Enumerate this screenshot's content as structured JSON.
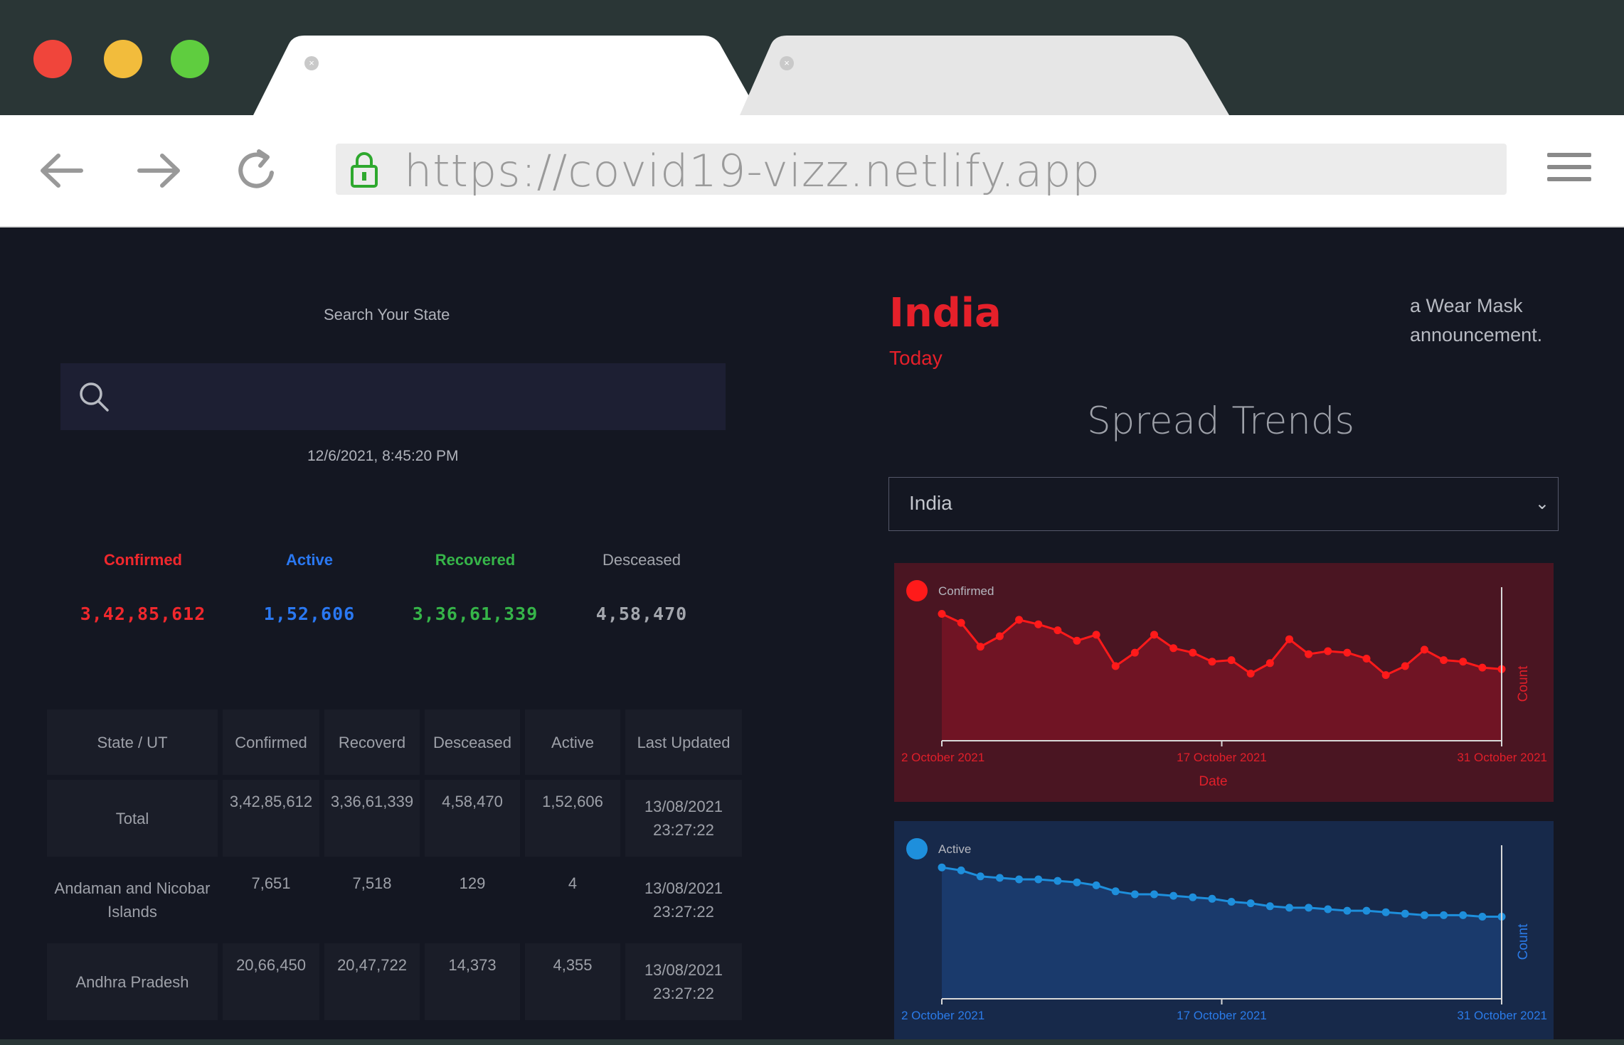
{
  "browser": {
    "url": "https://covid19-vizz.netlify.app",
    "tabs": [
      {
        "label": "",
        "close": "×"
      },
      {
        "label": "",
        "close": "×"
      }
    ]
  },
  "search": {
    "label": "Search Your State",
    "placeholder": ""
  },
  "timestamp": "12/6/2021, 8:45:20 PM",
  "stats": [
    {
      "label": "Confirmed",
      "value": "3,42,85,612",
      "color": "#f0282d"
    },
    {
      "label": "Active",
      "value": "1,52,606",
      "color": "#2a78f2"
    },
    {
      "label": "Recovered",
      "value": "3,36,61,339",
      "color": "#36b549"
    },
    {
      "label": "Desceased",
      "value": "4,58,470",
      "color": "#a3a6ad"
    }
  ],
  "table": {
    "headers": [
      "State / UT",
      "Confirmed",
      "Recoverd",
      "Desceased",
      "Active",
      "Last Updated"
    ],
    "rows": [
      [
        "Total",
        "3,42,85,612",
        "3,36,61,339",
        "4,58,470",
        "1,52,606",
        "13/08/2021 23:27:22"
      ],
      [
        "Andaman and Nicobar Islands",
        "7,651",
        "7,518",
        "129",
        "4",
        "13/08/2021 23:27:22"
      ],
      [
        "Andhra Pradesh",
        "20,66,450",
        "20,47,722",
        "14,373",
        "4,355",
        "13/08/2021 23:27:22"
      ]
    ]
  },
  "right": {
    "country": "India",
    "today": "Today",
    "announcement": "a Wear Mask announcement.",
    "spread_title": "Spread Trends",
    "selected_country": "India"
  },
  "chart_data": [
    {
      "type": "area",
      "legend": "Confirmed",
      "color": "#ff1a1a",
      "xlabel": "Date",
      "ylabel": "Count",
      "xticks": [
        "2 October 2021",
        "17 October 2021",
        "31 October 2021"
      ],
      "x": [
        "2021-10-02",
        "2021-10-03",
        "2021-10-04",
        "2021-10-05",
        "2021-10-06",
        "2021-10-07",
        "2021-10-08",
        "2021-10-09",
        "2021-10-10",
        "2021-10-11",
        "2021-10-12",
        "2021-10-13",
        "2021-10-14",
        "2021-10-15",
        "2021-10-16",
        "2021-10-17",
        "2021-10-18",
        "2021-10-19",
        "2021-10-20",
        "2021-10-21",
        "2021-10-22",
        "2021-10-23",
        "2021-10-24",
        "2021-10-25",
        "2021-10-26",
        "2021-10-27",
        "2021-10-28",
        "2021-10-29",
        "2021-10-30",
        "2021-10-31"
      ],
      "values": [
        0.85,
        0.79,
        0.63,
        0.7,
        0.81,
        0.78,
        0.74,
        0.67,
        0.71,
        0.5,
        0.59,
        0.71,
        0.62,
        0.59,
        0.53,
        0.54,
        0.45,
        0.52,
        0.68,
        0.58,
        0.6,
        0.59,
        0.55,
        0.44,
        0.5,
        0.61,
        0.54,
        0.53,
        0.49,
        0.48
      ]
    },
    {
      "type": "area",
      "legend": "Active",
      "color": "#1e8fdc",
      "ylabel": "Count",
      "xticks": [
        "2 October 2021",
        "17 October 2021",
        "31 October 2021"
      ],
      "x": [
        "2021-10-02",
        "2021-10-03",
        "2021-10-04",
        "2021-10-05",
        "2021-10-06",
        "2021-10-07",
        "2021-10-08",
        "2021-10-09",
        "2021-10-10",
        "2021-10-11",
        "2021-10-12",
        "2021-10-13",
        "2021-10-14",
        "2021-10-15",
        "2021-10-16",
        "2021-10-17",
        "2021-10-18",
        "2021-10-19",
        "2021-10-20",
        "2021-10-21",
        "2021-10-22",
        "2021-10-23",
        "2021-10-24",
        "2021-10-25",
        "2021-10-26",
        "2021-10-27",
        "2021-10-28",
        "2021-10-29",
        "2021-10-30",
        "2021-10-31"
      ],
      "values": [
        0.88,
        0.86,
        0.82,
        0.81,
        0.8,
        0.8,
        0.79,
        0.78,
        0.76,
        0.72,
        0.7,
        0.7,
        0.69,
        0.68,
        0.67,
        0.65,
        0.64,
        0.62,
        0.61,
        0.61,
        0.6,
        0.59,
        0.59,
        0.58,
        0.57,
        0.56,
        0.56,
        0.56,
        0.55,
        0.55
      ]
    }
  ]
}
